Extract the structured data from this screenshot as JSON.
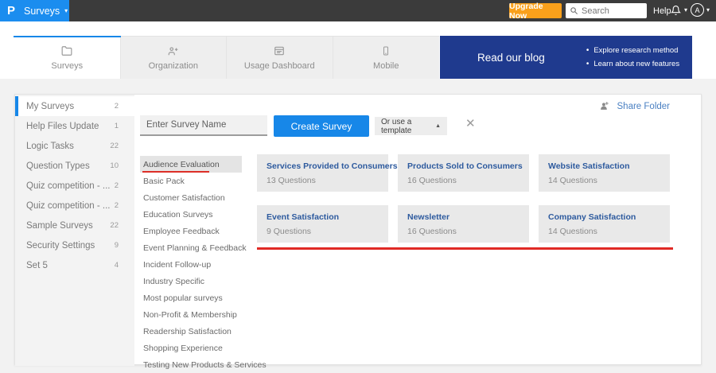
{
  "topbar": {
    "logo": "P",
    "product_menu": "Surveys",
    "upgrade_label": "Upgrade Now",
    "search_placeholder": "Search",
    "help_label": "Help",
    "avatar_initial": "A"
  },
  "nav_tabs": [
    {
      "label": "Surveys",
      "icon": "folder",
      "active": true
    },
    {
      "label": "Organization",
      "icon": "people-add",
      "active": false
    },
    {
      "label": "Usage Dashboard",
      "icon": "dashboard",
      "active": false
    },
    {
      "label": "Mobile",
      "icon": "mobile",
      "active": false
    }
  ],
  "blog_banner": {
    "title": "Read our blog",
    "bullets": [
      "Explore research method",
      "Learn about new features"
    ]
  },
  "sidebar": {
    "items": [
      {
        "label": "My Surveys",
        "count": "2",
        "active": true
      },
      {
        "label": "Help Files Update",
        "count": "1",
        "active": false
      },
      {
        "label": "Logic Tasks",
        "count": "22",
        "active": false
      },
      {
        "label": "Question Types",
        "count": "10",
        "active": false
      },
      {
        "label": "Quiz competition - ...",
        "count": "2",
        "active": false
      },
      {
        "label": "Quiz competition - ...",
        "count": "2",
        "active": false
      },
      {
        "label": "Sample Surveys",
        "count": "22",
        "active": false
      },
      {
        "label": "Security Settings",
        "count": "9",
        "active": false
      },
      {
        "label": "Set 5",
        "count": "4",
        "active": false
      }
    ]
  },
  "toolbar": {
    "survey_name_placeholder": "Enter Survey Name",
    "create_button": "Create Survey",
    "template_dropdown": "Or use a template",
    "share_folder": "Share Folder"
  },
  "templates": {
    "selected_category": "Audience Evaluation",
    "categories": [
      "Audience Evaluation",
      "Basic Pack",
      "Customer Satisfaction",
      "Education Surveys",
      "Employee Feedback",
      "Event Planning & Feedback",
      "Incident Follow-up",
      "Industry Specific",
      "Most popular surveys",
      "Non-Profit & Membership",
      "Readership Satisfaction",
      "Shopping Experience",
      "Testing New Products & Services"
    ],
    "cards": [
      {
        "title": "Services Provided to Consumers",
        "questions": "13 Questions"
      },
      {
        "title": "Products Sold to Consumers",
        "questions": "16 Questions"
      },
      {
        "title": "Website Satisfaction",
        "questions": "14 Questions"
      },
      {
        "title": "Event Satisfaction",
        "questions": "9 Questions"
      },
      {
        "title": "Newsletter",
        "questions": "16 Questions"
      },
      {
        "title": "Company Satisfaction",
        "questions": "14 Questions"
      }
    ]
  },
  "colors": {
    "brand_blue": "#1b8def",
    "action_blue": "#1787e8",
    "upgrade_orange": "#f9a01b",
    "banner_navy": "#1f3a8e",
    "card_title_blue": "#2d5a9e",
    "annotation_red": "#e02a25",
    "topbar_dark": "#3b3b3b"
  }
}
